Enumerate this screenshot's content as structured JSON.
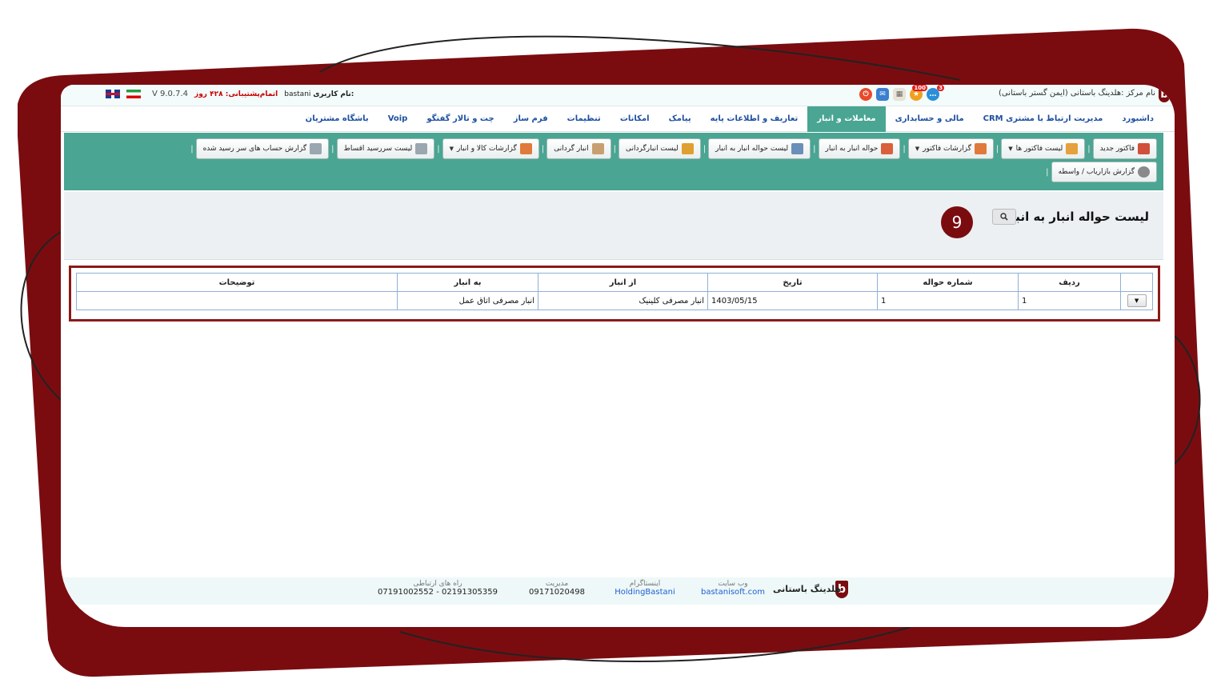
{
  "header": {
    "version": "V 9.0.7.4",
    "support_text": "اتمام‌پشتیبانی: ۴۲۸ روز",
    "username_label": "نام کاربری:",
    "username": "bastani",
    "center_name": "نام مرکز :هلدینگ باستانی (ایمن گستر باستانی)",
    "logo_letter": "b",
    "badge_count": "100",
    "msg_count": "3"
  },
  "mainnav": [
    "داشبورد",
    "مدیریت ارتباط با مشتری CRM",
    "مالی و حسابداری",
    "معاملات و انبار",
    "تعاریف و اطلاعات پایه",
    "پیامک",
    "امکانات",
    "تنظیمات",
    "فرم ساز",
    "چت و تالار گفتگو",
    "Voip",
    "باشگاه مشتریان"
  ],
  "toolbar": {
    "row1": [
      "فاکتور جدید",
      "لیست فاکتور ها",
      "گزارشات فاکتور",
      "حواله انبار به انبار",
      "لیست حواله انبار به انبار",
      "لیست انبارگردانی",
      "انبار گردانی",
      "گزارشات کالا و انبار",
      "لیست سررسید اقساط",
      "گزارش حساب های سر رسید شده"
    ],
    "row2": [
      "گزارش بازاریاب / واسطه"
    ]
  },
  "page": {
    "title": "لیست حواله انبار به انبار",
    "step_number": "9"
  },
  "table": {
    "headers": {
      "row_no": "ردیف",
      "transfer_no": "شماره حواله",
      "date": "تاریخ",
      "from": "از انبار",
      "to": "به انبار",
      "notes": "توضیحات"
    },
    "rows": [
      {
        "row_no": "1",
        "transfer_no": "1",
        "date": "1403/05/15",
        "from": "انبار مصرفی کلینیک",
        "to": "انبار مصرفی اتاق عمل",
        "notes": ""
      }
    ]
  },
  "footer": {
    "brand": "هلدینگ باستانی",
    "website_label": "وب سایت",
    "website": "bastanisoft.com",
    "instagram_label": "اینستاگرام",
    "instagram": "HoldingBastani",
    "management_label": "مدیریت",
    "management": "09171020498",
    "contact_label": "راه های ارتباطی",
    "contact": "07191002552 - 02191305359"
  },
  "colors": {
    "frame_accent": "#7a0c10",
    "toolbar_bg": "#4aa593",
    "nav_text": "#1e4fa0",
    "highlight_border": "#8b1a1a"
  }
}
